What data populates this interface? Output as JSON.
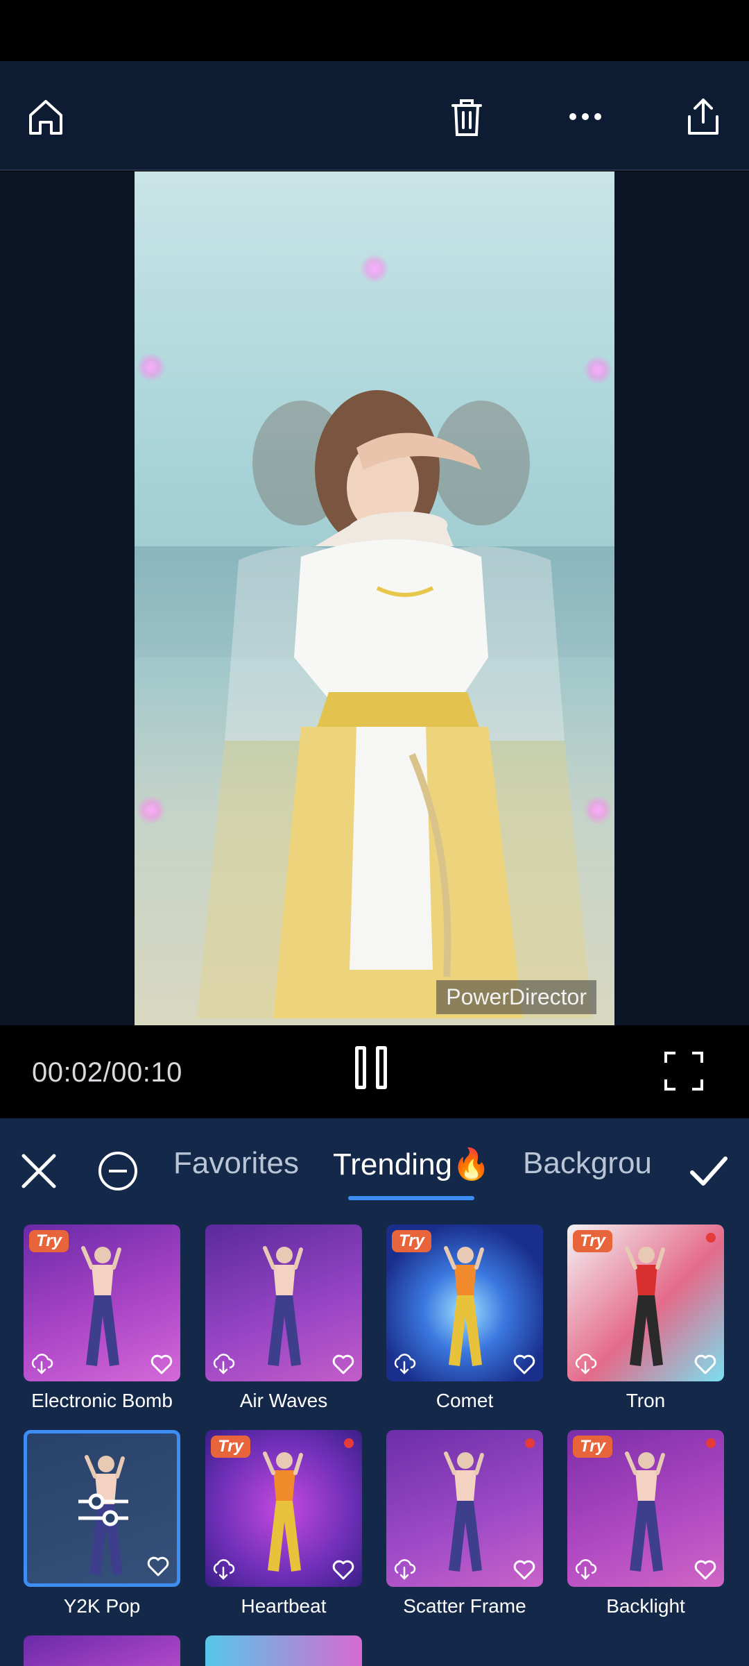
{
  "toolbar": {
    "icons": [
      "home-icon",
      "trash-icon",
      "more-icon",
      "share-icon"
    ]
  },
  "preview": {
    "watermark": "PowerDirector"
  },
  "player": {
    "time": "00:02/00:10",
    "icons": [
      "pause-icon",
      "fullscreen-icon"
    ]
  },
  "tabs": {
    "items": [
      "Favorites",
      "Trending🔥",
      "Backgrou"
    ],
    "active": "Trending🔥"
  },
  "colors": {
    "accent": "#3d8df5",
    "panel": "#14294a",
    "toolbar": "#0d1c33",
    "try_badge": "#e8643a",
    "new_dot": "#e53b3b"
  },
  "effects": [
    {
      "label": "Electronic Bomb",
      "try": "Try",
      "new_dot": false,
      "selected": false
    },
    {
      "label": "Air Waves",
      "try": "",
      "new_dot": false,
      "selected": false
    },
    {
      "label": "Comet",
      "try": "Try",
      "new_dot": false,
      "selected": false
    },
    {
      "label": "Tron",
      "try": "Try",
      "new_dot": true,
      "selected": false
    },
    {
      "label": "Y2K Pop",
      "try": "",
      "new_dot": false,
      "selected": true
    },
    {
      "label": "Heartbeat",
      "try": "Try",
      "new_dot": true,
      "selected": false
    },
    {
      "label": "Scatter Frame",
      "try": "",
      "new_dot": true,
      "selected": false
    },
    {
      "label": "Backlight",
      "try": "Try",
      "new_dot": true,
      "selected": false
    }
  ]
}
